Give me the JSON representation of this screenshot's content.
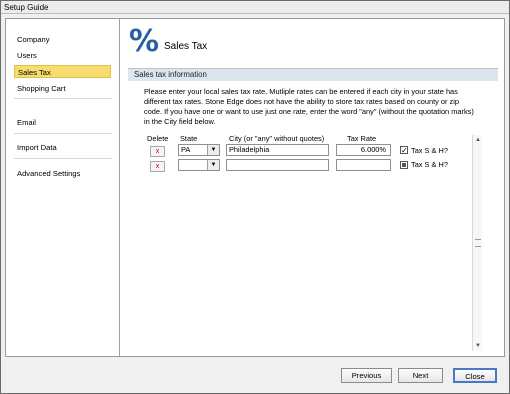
{
  "window": {
    "title": "Setup Guide"
  },
  "sidebar": {
    "items": [
      {
        "label": "Company"
      },
      {
        "label": "Users"
      },
      {
        "label": "Sales Tax"
      },
      {
        "label": "Shopping Cart"
      },
      {
        "label": "Email"
      },
      {
        "label": "Import Data"
      },
      {
        "label": "Advanced Settings"
      }
    ],
    "selected_index": 2,
    "selected_color": "#f7dc6f"
  },
  "page": {
    "icon": "percent-icon",
    "icon_glyph": "%",
    "title": "Sales Tax",
    "section_header": "Sales tax information",
    "instructions": "Please enter your local sales tax rate.  Mutliple rates can be entered if each city in your state has different tax rates.  Stone Edge does not have the ability to store tax rates based on county or zip code.  If you have one or want to use just one rate, enter the word \"any\" (without the quotation marks) in the City field below."
  },
  "grid": {
    "headers": {
      "delete": "Delete",
      "state": "State",
      "city": "City (or \"any\" without quotes)",
      "rate": "Tax Rate"
    },
    "delete_glyph": "x",
    "check_label": "Tax S & H?",
    "rows": [
      {
        "state": "PA",
        "city": "Philadelphia",
        "rate": "6.000%",
        "tax_sh": "checked"
      },
      {
        "state": "",
        "city": "",
        "rate": "",
        "tax_sh": "indeterminate"
      }
    ]
  },
  "footer": {
    "previous": "Previous",
    "next": "Next",
    "close": "Close"
  },
  "colors": {
    "icon": "#2a5fa0",
    "header_band": "#dde5ef",
    "delete_x": "#d10000"
  }
}
